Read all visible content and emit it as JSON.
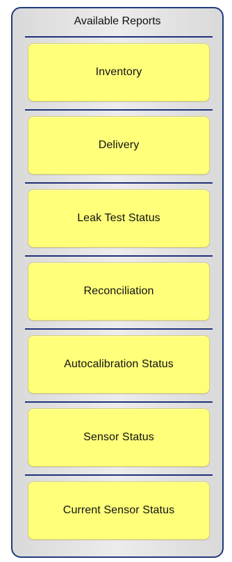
{
  "panel": {
    "title": "Available Reports"
  },
  "reports": [
    {
      "label": "Inventory"
    },
    {
      "label": "Delivery"
    },
    {
      "label": "Leak Test Status"
    },
    {
      "label": "Reconciliation"
    },
    {
      "label": "Autocalibration Status"
    },
    {
      "label": "Sensor Status"
    },
    {
      "label": "Current Sensor Status"
    }
  ],
  "colors": {
    "button_fill": "#ffff7a",
    "panel_border": "#1f3a7a",
    "divider": "#20307a"
  }
}
